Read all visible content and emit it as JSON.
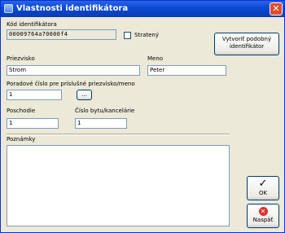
{
  "window": {
    "title": "Vlastnosti identifikátora",
    "close_glyph": "✕"
  },
  "id_code": {
    "label": "Kód identifikátora",
    "value": "00009764a70000f4"
  },
  "lost": {
    "label": "Stratený",
    "checked": false
  },
  "create_similar": {
    "label": "Vytvoriť podobný identifikátor"
  },
  "surname": {
    "label": "Priezvisko",
    "value": "Strom"
  },
  "firstname": {
    "label": "Meno",
    "value": "Peter"
  },
  "order": {
    "label": "Poradové číslo pre príslušné priezvisko/meno",
    "value": "1",
    "button": "..."
  },
  "floor": {
    "label": "Poschodie",
    "value": "1"
  },
  "room": {
    "label": "Číslo bytu/kancelárie",
    "value": "1"
  },
  "notes": {
    "label": "Poznámky",
    "value": ""
  },
  "ok": {
    "label": "OK",
    "icon": "✓"
  },
  "back": {
    "label": "Naspäť",
    "icon": "✕"
  },
  "colors": {
    "title_bar": "#0A4BD4",
    "background": "#ECE9D8",
    "close_red": "#E04A2A",
    "back_red": "#E0302A"
  }
}
